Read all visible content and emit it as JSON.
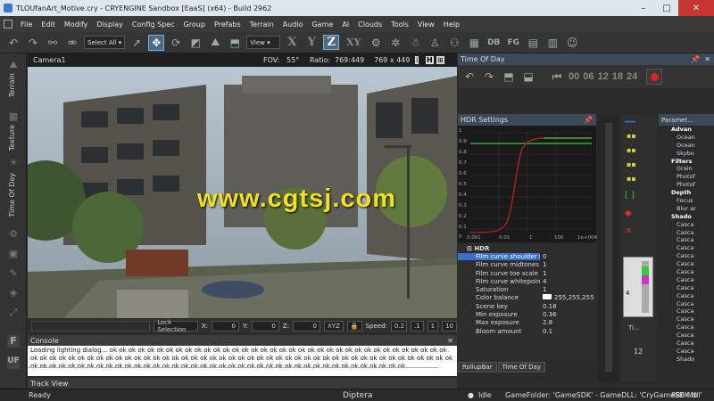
{
  "window": {
    "title": "TLOUfanArt_Motive.cry - CRYENGINE Sandbox [EaaS] (x64) - Build 2962"
  },
  "menu": [
    "File",
    "Edit",
    "Modify",
    "Display",
    "Config Spec",
    "Group",
    "Prefabs",
    "Terrain",
    "Audio",
    "Game",
    "AI",
    "Clouds",
    "Tools",
    "View",
    "Help"
  ],
  "toolbar": {
    "select_mode": "Select All",
    "view_mode": "View",
    "axes": [
      "X",
      "Y",
      "Z",
      "XY"
    ]
  },
  "left_tabs": [
    "Terrain",
    "Texture",
    "Time Of Day"
  ],
  "viewport": {
    "camera": "Camera1",
    "fov_label": "FOV:",
    "fov": "55°",
    "ratio_label": "Ratio:",
    "ratio": "769:449",
    "resolution": "769 x 449",
    "watermark": "www.cgtsj.com"
  },
  "viewport_status": {
    "lock_selection": "Lock Selection",
    "x_label": "X:",
    "x": "0",
    "y_label": "Y:",
    "y": "0",
    "z_label": "Z:",
    "z": "0",
    "xyz": "XYZ",
    "speed_label": "Speed:",
    "speed": "0.2",
    "speed_options": [
      ".1",
      "1",
      "10"
    ]
  },
  "console": {
    "title": "Console",
    "text": "Loading lighting dialog... ok ok ok ok ok ok ok ok ok ok ok ok ok ok ok ok ok ok ok ok ok ok ok ok ok ok ok ok ok ok ok ok ok ok ok ok ok ok ok ok ok ok ok ok ok ok ok ok ok ok ok ok ok ok ok ok ok ok ok ok ok ok ok ok ok ok ok ok ok ok ok ok ok ok ok ok ok ok ok ok ok ok ok ok ok ok ok ok ok ok ok ok ok ok ok ok ok ok ok ok ok ok ok ok ok ok ok ok ok ok ok ok ok ok ok ok ok ok ok ok ok"
  },
  "trackview": {
    "title": "Track View"
  },
  "statusbar": {
    "ready": "Ready",
    "center": "Diptera",
    "idle": "Idle",
    "game_folder": "GameFolder: 'GameSDK' - GameDLL: 'CryGameSDK.dll'",
    "memory": "886 Mb"
  },
  "time_of_day": {
    "title": "Time Of Day",
    "hours": [
      "00",
      "06",
      "12",
      "18",
      "24"
    ]
  },
  "hdr": {
    "title": "HDR Settings",
    "curve_ticks": [
      "0.001",
      "0.01",
      "1",
      "100",
      "1e+004"
    ],
    "y_ticks": [
      "1",
      "0.9",
      "0.8",
      "0.7",
      "0.6",
      "0.5",
      "0.4",
      "0.3",
      "0.2",
      "0.1",
      "0"
    ],
    "group": "HDR",
    "properties": [
      {
        "name": "Film curve shoulder scale",
        "value": "0"
      },
      {
        "name": "Film curve midtones scale",
        "value": "1"
      },
      {
        "name": "Film curve toe scale",
        "value": "1"
      },
      {
        "name": "Film curve whitepoint",
        "value": "4"
      },
      {
        "name": "Saturation",
        "value": "1"
      },
      {
        "name": "Color balance",
        "value": "255,255,255"
      },
      {
        "name": "Scene key",
        "value": "0.18"
      },
      {
        "name": "Min exposure",
        "value": "0.36"
      },
      {
        "name": "Max exposure",
        "value": "2.8"
      },
      {
        "name": "Bloom amount",
        "value": "0.1"
      }
    ]
  },
  "bottom_tabs": [
    "RollupBar",
    "Time Of Day"
  ],
  "slider": {
    "value": "12",
    "label": "Ti..."
  },
  "parameters": {
    "title": "Paramet...",
    "rows": [
      {
        "g": true,
        "t": "Advan"
      },
      {
        "t": "Ocean"
      },
      {
        "t": "Ocean"
      },
      {
        "t": "Skybo"
      },
      {
        "g": true,
        "t": "Filters"
      },
      {
        "t": "Grain"
      },
      {
        "t": "Photof"
      },
      {
        "t": "Photof"
      },
      {
        "g": true,
        "t": "Depth"
      },
      {
        "t": "Focus"
      },
      {
        "t": "Blur ar"
      },
      {
        "g": true,
        "t": "Shado"
      },
      {
        "t": "Casca"
      },
      {
        "t": "Casca"
      },
      {
        "t": "Casca"
      },
      {
        "t": "Casca"
      },
      {
        "t": "Casca"
      },
      {
        "t": "Casca"
      },
      {
        "t": "Casca"
      },
      {
        "t": "Casca"
      },
      {
        "t": "Casca"
      },
      {
        "t": "Casca"
      },
      {
        "t": "Casca"
      },
      {
        "t": "Casca"
      },
      {
        "t": "Casca"
      },
      {
        "t": "Casca"
      },
      {
        "t": "Casca"
      },
      {
        "t": "Casca"
      },
      {
        "t": "Casca"
      },
      {
        "t": "Shado"
      }
    ]
  },
  "colors": {
    "accent": "#4a6a88",
    "curve_green": "#3fbf3f",
    "curve_red": "#b02020",
    "watermark": "#f2e11a"
  }
}
